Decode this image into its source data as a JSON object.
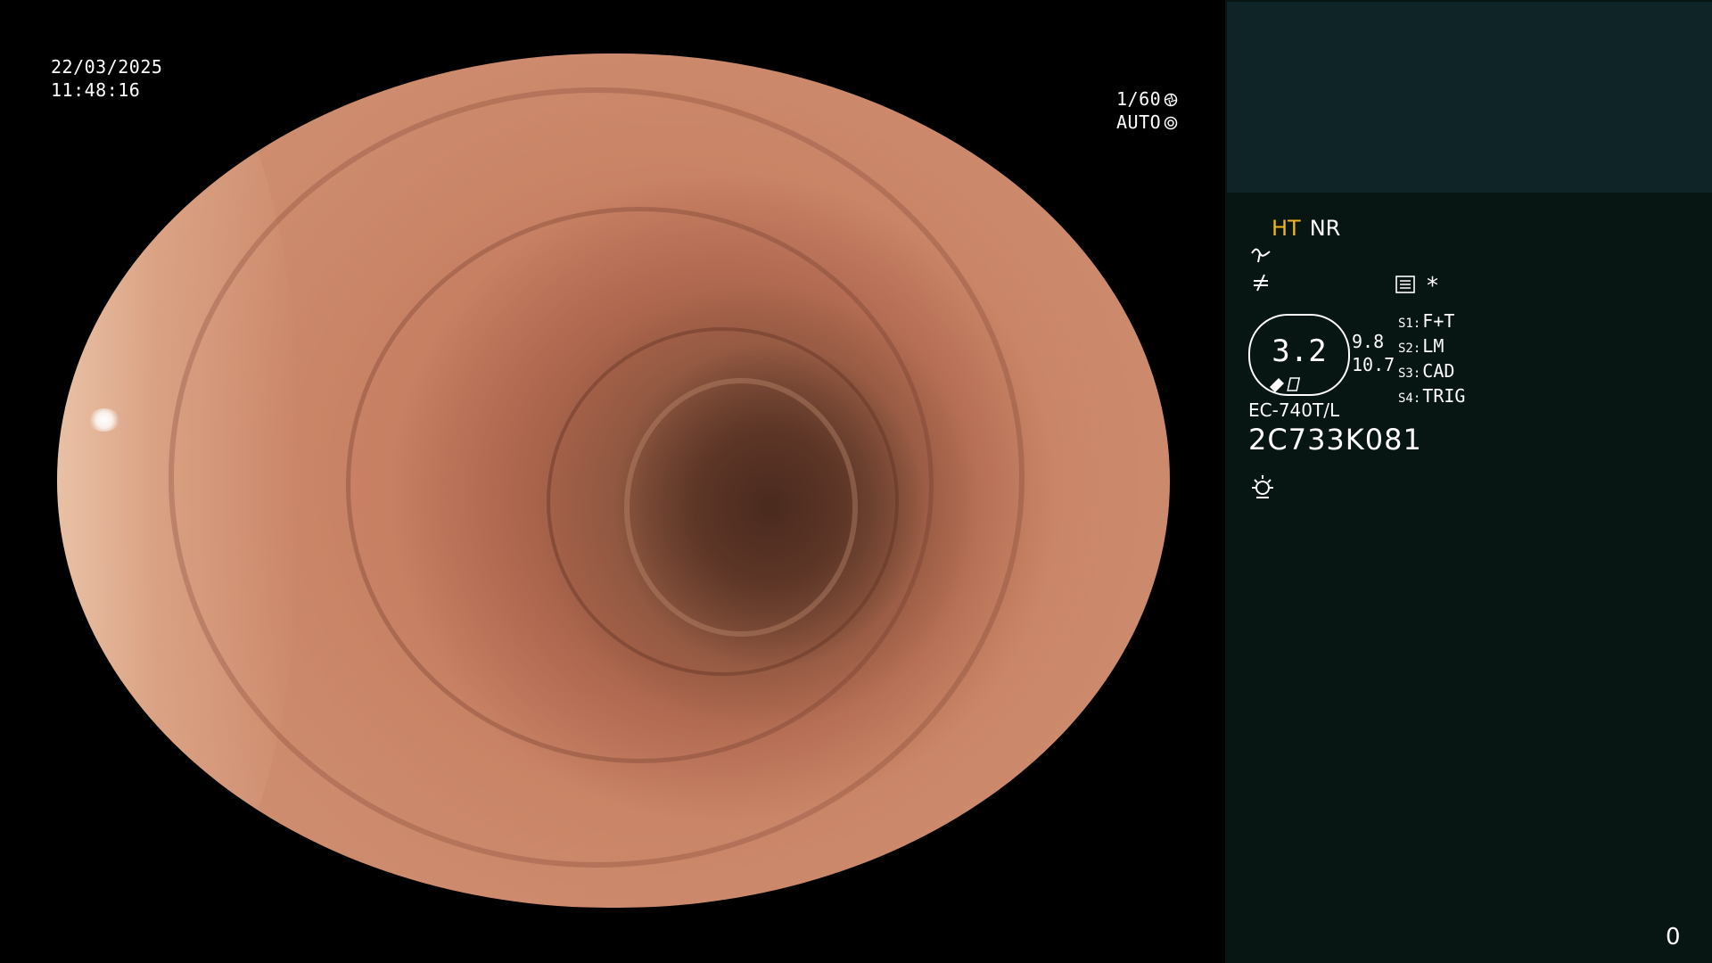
{
  "overlay": {
    "date": "22/03/2025",
    "time": "11:48:16",
    "shutter": "1/60",
    "mode": "AUTO"
  },
  "panel": {
    "mode_primary": "HT",
    "mode_secondary": "NR",
    "asterisk": "*",
    "zoom_value": "3.2",
    "side_value_1": "9.8",
    "side_value_2": "10.7",
    "settings": [
      {
        "key": "S1:",
        "value": "F+T"
      },
      {
        "key": "S2:",
        "value": "LM"
      },
      {
        "key": "S3:",
        "value": "CAD"
      },
      {
        "key": "S4:",
        "value": "TRIG"
      }
    ],
    "scope_model": "EC-740T/L",
    "scope_serial": "2C733K081",
    "counter": "0"
  },
  "colors": {
    "ht_accent": "#f0b423",
    "panel_bg": "#071513",
    "thumb_bg": "#0e2426"
  },
  "icons": [
    "shutter-icon",
    "iris-icon",
    "wave-icon",
    "not-equal-icon",
    "settings-list-icon",
    "light-source-icon"
  ]
}
